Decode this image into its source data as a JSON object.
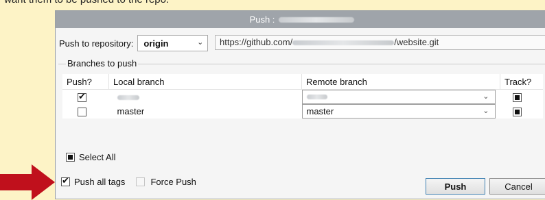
{
  "page": {
    "instruction_text": "want them to be pushed to the repo."
  },
  "dialog": {
    "title_prefix": "Push :",
    "push_to_repository_label": "Push to repository:",
    "remote_selected": "origin",
    "remote_url": {
      "prefix": "https://github.com/",
      "suffix": "/website.git"
    }
  },
  "branches": {
    "group_label": "Branches to push",
    "columns": [
      "Push?",
      "Local branch",
      "Remote branch",
      "Track?"
    ],
    "rows": [
      {
        "push": true,
        "local": "",
        "remote": "",
        "track": true
      },
      {
        "push": false,
        "local": "master",
        "remote": "master",
        "track": true
      }
    ],
    "select_all_label": "Select All",
    "select_all_checked": true
  },
  "options": {
    "push_all_tags_label": "Push all tags",
    "push_all_tags_checked": true,
    "force_push_label": "Force Push",
    "force_push_checked": false
  },
  "buttons": {
    "push": "Push",
    "cancel": "Cancel"
  },
  "colors": {
    "background": "#fdf3c6",
    "titlebar": "#9fa4aa",
    "arrow": "#c0101c"
  }
}
